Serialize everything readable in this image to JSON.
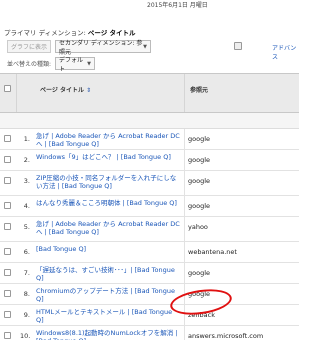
{
  "report": {
    "date": "2015年6月1日 月曜日",
    "primary_dimension_label": "プライマリ ディメンション:",
    "primary_dimension_value": "ページ タイトル"
  },
  "controls": {
    "plot_button": "グラフに表示",
    "secondary_dimension": "セカンダリ ディメンション: 参照元",
    "sort_label": "並べ替えの種類:",
    "sort_value": "デフォルト",
    "advanced_link": "アドバンス"
  },
  "table": {
    "col_page_title": "ページ タイトル",
    "col_referrer": "参照元",
    "rows": [
      {
        "num": "1.",
        "page": "急げ | Adobe Reader から Acrobat Reader DC へ | [Bad Tongue Q]",
        "ref": "google"
      },
      {
        "num": "2.",
        "page": "Windows「9」はどこへ？ | [Bad Tongue Q]",
        "ref": "google"
      },
      {
        "num": "3.",
        "page": "ZIP圧縮の小技・同名フォルダーを入れ子にしない方法 | [Bad Tongue Q]",
        "ref": "google"
      },
      {
        "num": "4.",
        "page": "はんなり秀麗＆こころ明朝体 | [Bad Tongue Q]",
        "ref": "google"
      },
      {
        "num": "5.",
        "page": "急げ | Adobe Reader から Acrobat Reader DC へ | [Bad Tongue Q]",
        "ref": "yahoo"
      },
      {
        "num": "6.",
        "page": "[Bad Tongue Q]",
        "ref": "webantena.net"
      },
      {
        "num": "7.",
        "page": "「遅延なうは、すごい技術･･･」| [Bad Tongue Q]",
        "ref": "google"
      },
      {
        "num": "8.",
        "page": "Chromiumのアップデート方法 | [Bad Tongue Q]",
        "ref": "google"
      },
      {
        "num": "9.",
        "page": "HTMLメールとテキストメール | [Bad Tongue Q]",
        "ref": "zenback"
      },
      {
        "num": "10.",
        "page": "Windows8(8.1)起動時のNumLockオフを解消 | [Bad Tongue Q]",
        "ref": "answers.microsoft.com"
      }
    ]
  },
  "colors": {
    "link": "#1a56b8",
    "highlight": "#e01010"
  }
}
